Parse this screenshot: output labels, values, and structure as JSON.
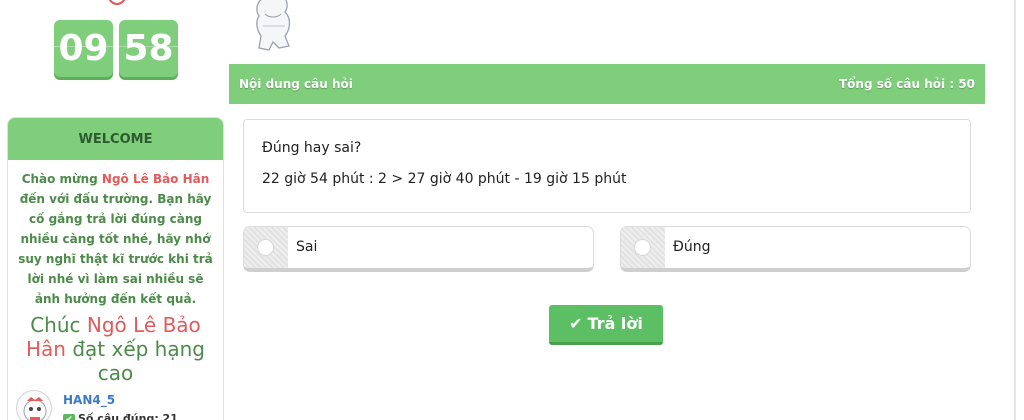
{
  "timer": {
    "minutes": "09",
    "seconds": "58"
  },
  "welcome": {
    "title": "WELCOME",
    "msg_1": "Chào mừng ",
    "name": "Ngô Lê Bảo Hân",
    "msg_2": " đến với đấu trường. Bạn hãy cố gắng trả lời đúng càng nhiều càng tốt nhé, hãy nhớ suy nghĩ thật kĩ trước khi trả lời nhé vì làm sai nhiều sẽ ảnh hưởng đến kết quả.",
    "wish_1": "Chúc ",
    "wish_2": " đạt xếp hạng cao"
  },
  "user": {
    "username": "HAN4_5",
    "correct_label": "Số câu đúng: 21"
  },
  "question_header": {
    "label": "Nội dung câu hỏi",
    "total": "Tổng số câu hỏi : 50"
  },
  "question": {
    "type": "Đúng hay sai?",
    "text": "22 giờ 54 phút : 2 > 27 giờ 40 phút - 19 giờ 15 phút"
  },
  "options": [
    "Sai",
    "Đúng"
  ],
  "submit_label": "Trả lời",
  "colors": {
    "accent": "#7fce7c",
    "button": "#5cbf63",
    "name_highlight": "#e25b5b",
    "text_green": "#4c8b49"
  }
}
